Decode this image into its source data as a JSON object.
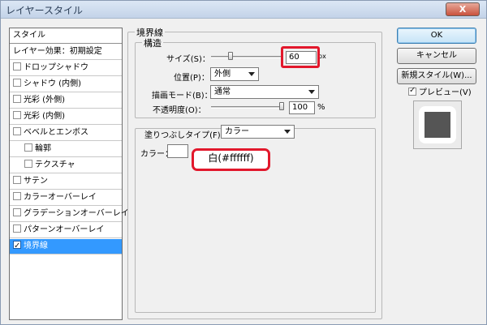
{
  "window": {
    "title": "レイヤースタイル",
    "close": "X"
  },
  "style_list": {
    "header": "スタイル",
    "blend_options": "レイヤー効果：初期設定",
    "items": [
      {
        "label": "ドロップシャドウ",
        "checked": false
      },
      {
        "label": "シャドウ (内側)",
        "checked": false
      },
      {
        "label": "光彩 (外側)",
        "checked": false
      },
      {
        "label": "光彩 (内側)",
        "checked": false
      },
      {
        "label": "ベベルとエンボス",
        "checked": false
      },
      {
        "label": "輪郭",
        "checked": false
      },
      {
        "label": "テクスチャ",
        "checked": false
      },
      {
        "label": "サテン",
        "checked": false
      },
      {
        "label": "カラーオーバーレイ",
        "checked": false
      },
      {
        "label": "グラデーションオーバーレイ",
        "checked": false
      },
      {
        "label": "パターンオーバーレイ",
        "checked": false
      },
      {
        "label": "境界線",
        "checked": true
      }
    ]
  },
  "stroke": {
    "section_title": "境界線",
    "structure_title": "構造",
    "size_label": "サイズ(S)：",
    "size_value": "60",
    "size_unit": "px",
    "size_slider_level": 0.15,
    "position_label": "位置(P)：",
    "position_value": "外側",
    "blend_label": "描画モード(B)：",
    "blend_value": "通常",
    "opacity_label": "不透明度(O)：",
    "opacity_value": "100",
    "opacity_unit": "%",
    "opacity_slider_level": 1.0,
    "fill_type_label": "塗りつぶしタイプ(F)：",
    "fill_type_value": "カラー",
    "color_label": "カラー：",
    "color_value": "#ffffff"
  },
  "annotation": {
    "text": "白(#ffffff)"
  },
  "buttons": {
    "ok": "OK",
    "cancel": "キャンセル",
    "new_style": "新規スタイル(W)...",
    "preview_label": "プレビュー(V)",
    "preview_checked": true
  },
  "colors": {
    "highlight": "#e2182c",
    "selected": "#3399ff",
    "preview_shape": "#555555"
  }
}
